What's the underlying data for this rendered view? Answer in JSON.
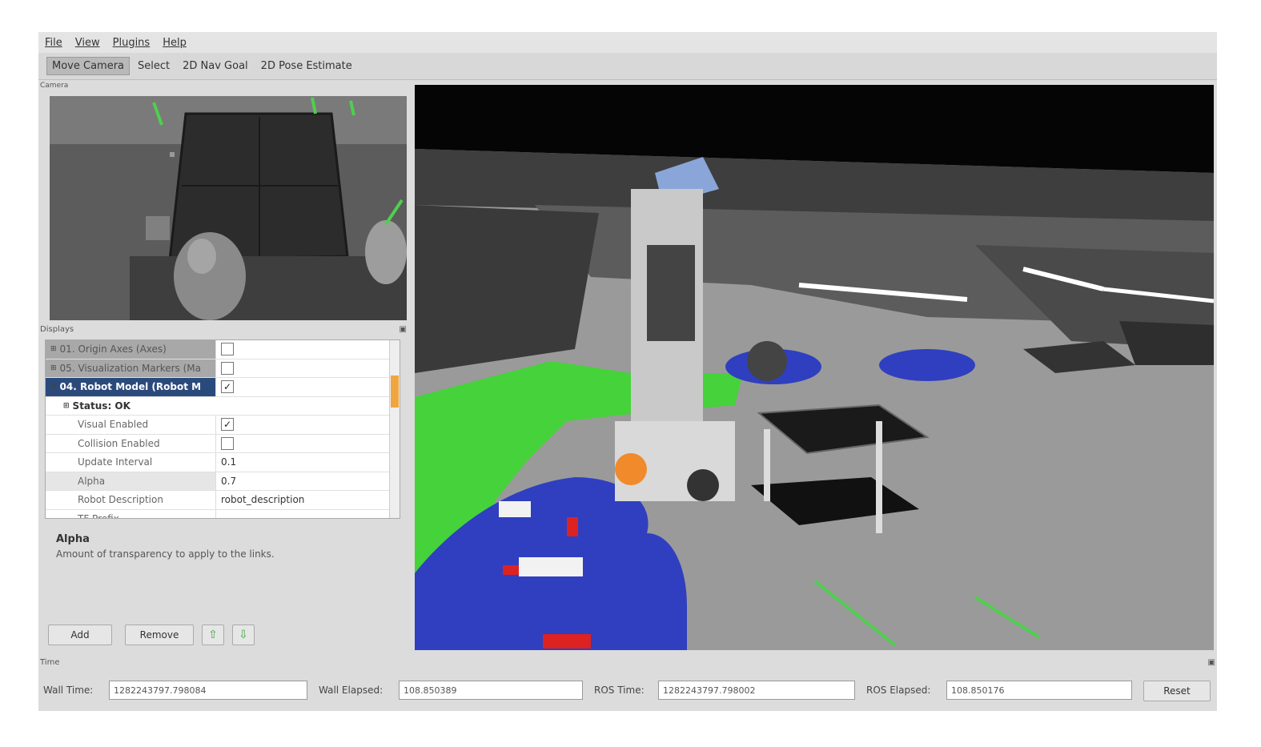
{
  "menu": [
    "File",
    "View",
    "Plugins",
    "Help"
  ],
  "toolbar": {
    "tools": [
      "Move Camera",
      "Select",
      "2D Nav Goal",
      "2D Pose Estimate"
    ],
    "active_index": 0
  },
  "camera_panel": {
    "title": "Camera"
  },
  "displays": {
    "title": "Displays",
    "rows": [
      {
        "label": "01. Origin Axes (Axes)",
        "checked": false,
        "style": "grey"
      },
      {
        "label": "05. Visualization Markers (Ma",
        "checked": false,
        "style": "grey"
      },
      {
        "label": "04. Robot Model (Robot M",
        "checked": true,
        "style": "sel"
      }
    ],
    "status_label": "Status: OK",
    "properties": [
      {
        "label": "Visual Enabled",
        "value": "",
        "checkbox": true,
        "checked": true
      },
      {
        "label": "Collision Enabled",
        "value": "",
        "checkbox": true,
        "checked": false
      },
      {
        "label": "Update Interval",
        "value": "0.1"
      },
      {
        "label": "Alpha",
        "value": "0.7",
        "highlight": true
      },
      {
        "label": "Robot Description",
        "value": "robot_description"
      },
      {
        "label": "TF Prefix",
        "value": ""
      }
    ]
  },
  "description": {
    "title": "Alpha",
    "text": "Amount of transparency to apply to the links."
  },
  "buttons": {
    "add": "Add",
    "remove": "Remove",
    "up": "⇧",
    "down": "⇩"
  },
  "time": {
    "title": "Time",
    "wall_time_label": "Wall Time:",
    "wall_time": "1282243797.798084",
    "wall_elapsed_label": "Wall Elapsed:",
    "wall_elapsed": "108.850389",
    "ros_time_label": "ROS Time:",
    "ros_time": "1282243797.798002",
    "ros_elapsed_label": "ROS Elapsed:",
    "ros_elapsed": "108.850176",
    "reset_label": "Reset"
  },
  "colors": {
    "costmap_blue": "#2f3fc0",
    "obstacle_green": "#45d23a",
    "selection": "#2b4a7c"
  }
}
